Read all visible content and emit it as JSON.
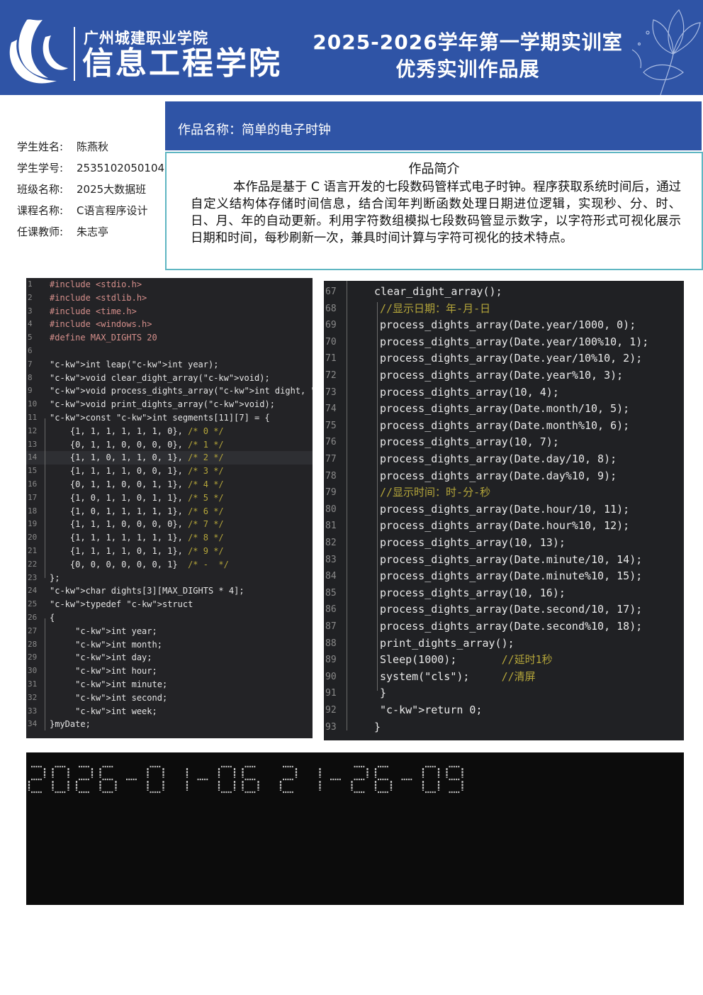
{
  "header": {
    "school": "广州城建职业学院",
    "college": "信息工程学院",
    "event_line1": "2025-2026学年第一学期实训室",
    "event_line2": "优秀实训作品展",
    "brand_color": "#2f54a6"
  },
  "student": [
    {
      "label": "学生姓名:",
      "value": "陈燕秋"
    },
    {
      "label": "学生学号:",
      "value": "2535102050104"
    },
    {
      "label": "班级名称:",
      "value": "2025大数据班"
    },
    {
      "label": "课程名称:",
      "value": "C语言程序设计"
    },
    {
      "label": "任课教师:",
      "value": "朱志亭"
    }
  ],
  "work": {
    "title": "作品名称：简单的电子时钟",
    "intro_heading": "作品简介",
    "intro_text": "本作品是基于 C 语言开发的七段数码管样式电子时钟。程序获取系统时间后，通过自定义结构体存储时间信息，结合闰年判断函数处理日期进位逻辑，实现秒、分、时、日、月、年的自动更新。利用字符数组模拟七段数码管显示数字，以字符形式可视化展示日期和时间，每秒刷新一次，兼具时间计算与字符可视化的技术特点。"
  },
  "code_left": [
    {
      "n": "1",
      "t": "#include <stdio.h>"
    },
    {
      "n": "2",
      "t": "#include <stdlib.h>"
    },
    {
      "n": "3",
      "t": "#include <time.h>"
    },
    {
      "n": "4",
      "t": "#include <windows.h>"
    },
    {
      "n": "5",
      "t": "#define MAX_DIGHTS 20"
    },
    {
      "n": "6",
      "t": ""
    },
    {
      "n": "7",
      "t": "int leap(int year);"
    },
    {
      "n": "8",
      "t": "void clear_dight_array(void);"
    },
    {
      "n": "9",
      "t": "void process_dights_array(int dight, int position);"
    },
    {
      "n": "10",
      "t": "void print_dights_array(void);"
    },
    {
      "n": "11",
      "t": "const int segments[11][7] = {"
    },
    {
      "n": "12",
      "t": "    {1, 1, 1, 1, 1, 1, 0}, /* 0 */"
    },
    {
      "n": "13",
      "t": "    {0, 1, 1, 0, 0, 0, 0}, /* 1 */"
    },
    {
      "n": "14",
      "t": "    {1, 1, 0, 1, 1, 0, 1}, /* 2 */"
    },
    {
      "n": "15",
      "t": "    {1, 1, 1, 1, 0, 0, 1}, /* 3 */"
    },
    {
      "n": "16",
      "t": "    {0, 1, 1, 0, 0, 1, 1}, /* 4 */"
    },
    {
      "n": "17",
      "t": "    {1, 0, 1, 1, 0, 1, 1}, /* 5 */"
    },
    {
      "n": "18",
      "t": "    {1, 0, 1, 1, 1, 1, 1}, /* 6 */"
    },
    {
      "n": "19",
      "t": "    {1, 1, 1, 0, 0, 0, 0}, /* 7 */"
    },
    {
      "n": "20",
      "t": "    {1, 1, 1, 1, 1, 1, 1}, /* 8 */"
    },
    {
      "n": "21",
      "t": "    {1, 1, 1, 1, 0, 1, 1}, /* 9 */"
    },
    {
      "n": "22",
      "t": "    {0, 0, 0, 0, 0, 0, 1}  /* -  */"
    },
    {
      "n": "23",
      "t": "};"
    },
    {
      "n": "24",
      "t": "char dights[3][MAX_DIGHTS * 4];"
    },
    {
      "n": "25",
      "t": "typedef struct"
    },
    {
      "n": "26",
      "t": "{"
    },
    {
      "n": "27",
      "t": "     int year;"
    },
    {
      "n": "28",
      "t": "     int month;"
    },
    {
      "n": "29",
      "t": "     int day;"
    },
    {
      "n": "30",
      "t": "     int hour;"
    },
    {
      "n": "31",
      "t": "     int minute;"
    },
    {
      "n": "32",
      "t": "     int second;"
    },
    {
      "n": "33",
      "t": "     int week;"
    },
    {
      "n": "34",
      "t": "}myDate;"
    }
  ],
  "code_right": [
    {
      "n": "67",
      "t": "clear_dight_array();",
      "i": 0
    },
    {
      "n": "68",
      "t": "//显示日期：年-月-日",
      "i": 1
    },
    {
      "n": "69",
      "t": "process_dights_array(Date.year/1000, 0);",
      "i": 1
    },
    {
      "n": "70",
      "t": "process_dights_array(Date.year/100%10, 1);",
      "i": 1
    },
    {
      "n": "71",
      "t": "process_dights_array(Date.year/10%10, 2);",
      "i": 1
    },
    {
      "n": "72",
      "t": "process_dights_array(Date.year%10, 3);",
      "i": 1
    },
    {
      "n": "73",
      "t": "process_dights_array(10, 4);",
      "i": 1
    },
    {
      "n": "74",
      "t": "process_dights_array(Date.month/10, 5);",
      "i": 1
    },
    {
      "n": "75",
      "t": "process_dights_array(Date.month%10, 6);",
      "i": 1
    },
    {
      "n": "76",
      "t": "process_dights_array(10, 7);",
      "i": 1
    },
    {
      "n": "77",
      "t": "process_dights_array(Date.day/10, 8);",
      "i": 1
    },
    {
      "n": "78",
      "t": "process_dights_array(Date.day%10, 9);",
      "i": 1
    },
    {
      "n": "79",
      "t": "//显示时间：时-分-秒",
      "i": 1
    },
    {
      "n": "80",
      "t": "process_dights_array(Date.hour/10, 11);",
      "i": 1
    },
    {
      "n": "81",
      "t": "process_dights_array(Date.hour%10, 12);",
      "i": 1
    },
    {
      "n": "82",
      "t": "process_dights_array(10, 13);",
      "i": 1
    },
    {
      "n": "83",
      "t": "process_dights_array(Date.minute/10, 14);",
      "i": 1
    },
    {
      "n": "84",
      "t": "process_dights_array(Date.minute%10, 15);",
      "i": 1
    },
    {
      "n": "85",
      "t": "process_dights_array(10, 16);",
      "i": 1
    },
    {
      "n": "86",
      "t": "process_dights_array(Date.second/10, 17);",
      "i": 1
    },
    {
      "n": "87",
      "t": "process_dights_array(Date.second%10, 18);",
      "i": 1
    },
    {
      "n": "88",
      "t": "print_dights_array();",
      "i": 1
    },
    {
      "n": "89",
      "t": "Sleep(1000);       //延时1秒",
      "i": 1
    },
    {
      "n": "90",
      "t": "system(\"cls\");     //清屏",
      "i": 1
    },
    {
      "n": "91",
      "t": "}",
      "i": 1
    },
    {
      "n": "92",
      "t": "return 0;",
      "i": 1
    },
    {
      "n": "93",
      "t": "}",
      "i": 0
    }
  ],
  "output": {
    "display": "2026-01-06 21-26-09"
  }
}
